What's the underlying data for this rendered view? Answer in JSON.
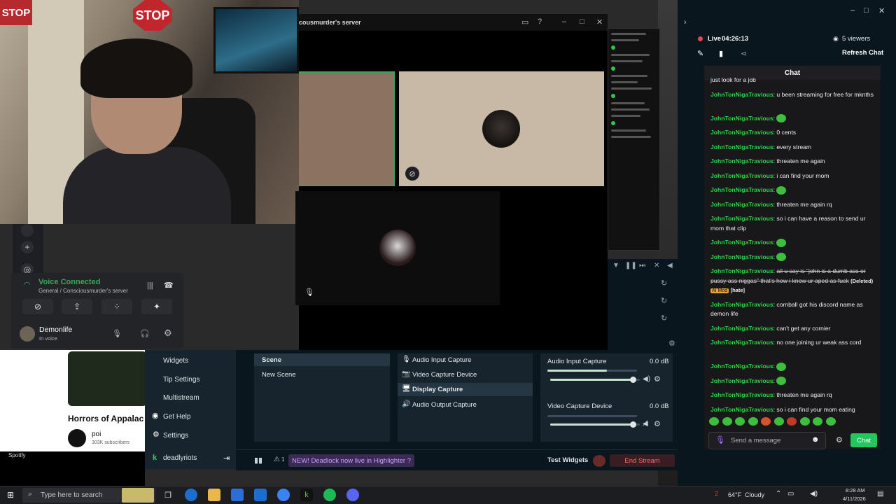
{
  "webcam": {
    "stop_sign_text": "STOP",
    "stop_sign_partial": "STOP"
  },
  "discord": {
    "call_title": "cousmurder's server",
    "voice": {
      "status": "Voice Connected",
      "channel": "General / Consciousmurder's server"
    },
    "user": {
      "name": "Demonlife",
      "status": "In voice"
    }
  },
  "youtube": {
    "video_title": "Horrors of Appalac",
    "channel_name": "poi",
    "subscribers": "303K subscribers"
  },
  "spotify": {
    "label": "Spotify"
  },
  "streamlabs": {
    "sidebar": [
      {
        "label": "Widgets",
        "icon": "widgets-icon"
      },
      {
        "label": "Tip Settings",
        "icon": "tip-icon"
      },
      {
        "label": "Multistream",
        "icon": "multistream-icon"
      },
      {
        "label": "Get Help",
        "icon": "help-icon"
      },
      {
        "label": "Settings",
        "icon": "gear-icon"
      }
    ],
    "account": "deadlyriots",
    "scenes": {
      "header": "Scene",
      "items": [
        "New Scene"
      ]
    },
    "sources": [
      {
        "label": "Audio Input Capture",
        "icon": "mic-icon",
        "selected": false
      },
      {
        "label": "Video Capture Device",
        "icon": "camera-icon",
        "selected": false
      },
      {
        "label": "Display Capture",
        "icon": "monitor-icon",
        "selected": true
      },
      {
        "label": "Audio Output Capture",
        "icon": "speaker-icon",
        "selected": false
      }
    ],
    "mixer": [
      {
        "name": "Audio Input Capture",
        "level": "0.0 dB",
        "volume": 0.92
      },
      {
        "name": "Video Capture Device",
        "level": "0.0 dB",
        "volume": 0.92
      }
    ],
    "footer": {
      "alert_count": "1",
      "news": "NEW! Deadlock now live in Highlighter ?",
      "test_widgets": "Test Widgets",
      "end_stream": "End Stream"
    },
    "live": {
      "label": "Live",
      "time": "04:26:13",
      "viewers": "5 viewers",
      "refresh": "Refresh Chat"
    }
  },
  "chat": {
    "title": "Chat",
    "messages": [
      {
        "user": "",
        "text": "just look for a job",
        "emote": false,
        "deleted": false
      },
      {
        "user": "JohnTonNigaTravious",
        "text": "u been streaming for free for mknths",
        "emote": false,
        "deleted": false
      },
      {
        "user": "JohnTonNigaTravious",
        "text": "",
        "emote": true,
        "deleted": false
      },
      {
        "user": "JohnTonNigaTravious",
        "text": "0 cents",
        "emote": false,
        "deleted": false
      },
      {
        "user": "JohnTonNigaTravious",
        "text": "every stream",
        "emote": false,
        "deleted": false
      },
      {
        "user": "JohnTonNigaTravious",
        "text": "threaten me again",
        "emote": false,
        "deleted": false
      },
      {
        "user": "JohnTonNigaTravious",
        "text": "i can find your mom",
        "emote": false,
        "deleted": false
      },
      {
        "user": "JohnTonNigaTravious",
        "text": "",
        "emote": true,
        "deleted": false
      },
      {
        "user": "JohnTonNigaTravious",
        "text": "threaten me again rq",
        "emote": false,
        "deleted": false
      },
      {
        "user": "JohnTonNigaTravious",
        "text": "so i can have a reason to send ur mom that clip",
        "emote": false,
        "deleted": false
      },
      {
        "user": "JohnTonNigaTravious",
        "text": "",
        "emote": true,
        "deleted": false
      },
      {
        "user": "JohnTonNigaTravious",
        "text": "",
        "emote": true,
        "deleted": false
      },
      {
        "user": "JohnTonNigaTravious",
        "text": "all u say is \"john is a dumb ass or pussy ass niggas\" that's how i know ur aped as fuck",
        "emote": false,
        "deleted": true,
        "deleted_tag": "(Deleted)",
        "mod_tag": "AI Mod",
        "reason": "[hate]"
      },
      {
        "user": "JohnTonNigaTravious",
        "text": "cornball got his discord name as demon life",
        "emote": false,
        "deleted": false
      },
      {
        "user": "JohnTonNigaTravious",
        "text": "can't get any cornier",
        "emote": false,
        "deleted": false
      },
      {
        "user": "JohnTonNigaTravious",
        "text": "no one joining ur weak ass cord",
        "emote": false,
        "deleted": false
      },
      {
        "user": "JohnTonNigaTravious",
        "text": "",
        "emote": true,
        "deleted": false
      },
      {
        "user": "JohnTonNigaTravious",
        "text": "",
        "emote": true,
        "deleted": false
      },
      {
        "user": "JohnTonNigaTravious",
        "text": "threaten me again rq",
        "emote": false,
        "deleted": false
      },
      {
        "user": "JohnTonNigaTravious",
        "text": "so i can find your mom eating",
        "emote": false,
        "deleted": false
      }
    ],
    "input_placeholder": "Send a message",
    "send_label": "Chat",
    "accent": "#2fd34a"
  },
  "taskbar": {
    "search_placeholder": "Type here to search",
    "weather_temp": "64°F",
    "weather_desc": "Cloudy",
    "notification_count": "2",
    "time": "8:28 AM",
    "date": "4/11/2026"
  }
}
